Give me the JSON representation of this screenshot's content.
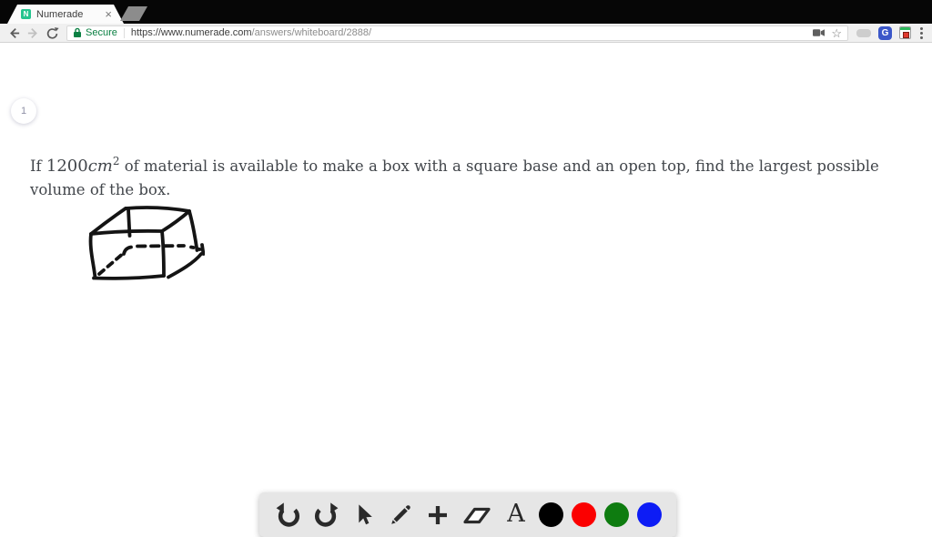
{
  "browser": {
    "tab_title": "Numerade",
    "tab_close": "×",
    "favicon_letter": "N",
    "security_label": "Secure",
    "url_domain": "https://www.numerade.com",
    "url_path": "/answers/whiteboard/2888/",
    "star_glyph": "☆",
    "extension_g_label": "G"
  },
  "whiteboard": {
    "page_number": "1",
    "problem_prefix": "If ",
    "math_coefficient": "1200",
    "math_unit": "cm",
    "math_exponent": "2",
    "problem_line1_rest": " of material is available to make a box with a square base and an open top, find the largest possible",
    "problem_line2": "volume of the box.",
    "sketch_description": "hand-drawn open-top box with dashed hidden edges"
  },
  "toolbar": {
    "tools": [
      "undo",
      "redo",
      "select",
      "pencil",
      "add",
      "eraser",
      "text"
    ],
    "text_tool_label": "A",
    "colors": [
      {
        "name": "black",
        "hex": "#000000"
      },
      {
        "name": "red",
        "hex": "#fb0000"
      },
      {
        "name": "green",
        "hex": "#0e7c10"
      },
      {
        "name": "blue",
        "hex": "#0d1cf5"
      }
    ]
  }
}
